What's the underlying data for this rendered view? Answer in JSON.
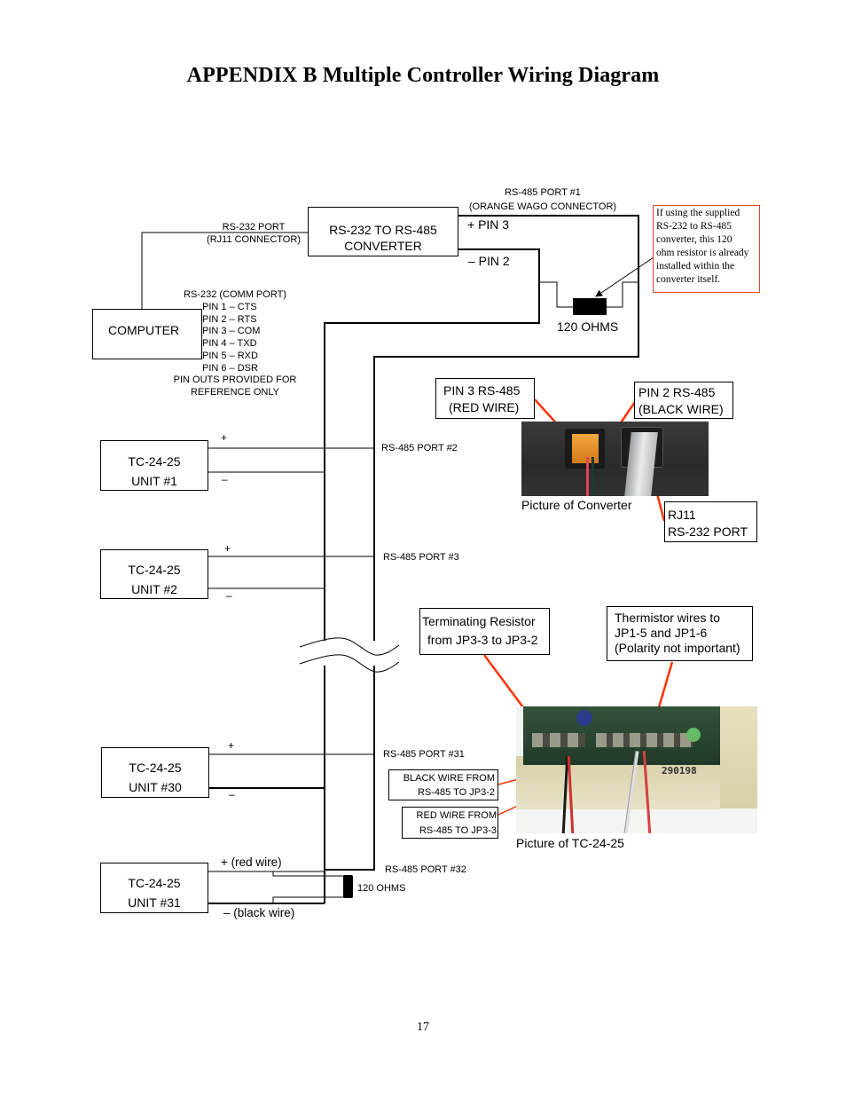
{
  "page": {
    "title": "APPENDIX B Multiple Controller Wiring Diagram",
    "page_number": "17"
  },
  "computer": {
    "label": "COMPUTER",
    "port_label": "RS-232 (COMM PORT)",
    "pins": [
      "PIN 1 – CTS",
      "PIN 2 – RTS",
      "PIN 3 – COM",
      "PIN 4 – TXD",
      "PIN 5 – RXD",
      "PIN 6 – DSR"
    ],
    "pin_note_line1": "PIN OUTS PROVIDED FOR",
    "pin_note_line2": "REFERENCE ONLY"
  },
  "converter": {
    "line1": "RS-232 TO RS-485",
    "line2": "CONVERTER",
    "rs232_port_line1": "RS-232 PORT",
    "rs232_port_line2": "(RJ11 CONNECTOR)",
    "rs485_port_line1": "RS-485 PORT #1",
    "rs485_port_line2": "(ORANGE WAGO CONNECTOR)",
    "pin3": "+ PIN 3",
    "pin2": "– PIN 2",
    "resistor": "120 OHMS"
  },
  "resistor_note": {
    "lines": [
      "If using the supplied",
      "RS-232 to RS-485",
      "converter, this 120",
      "ohm resistor is already",
      "installed within the",
      "converter itself."
    ],
    "border_color": "#e2452a"
  },
  "units": [
    {
      "model": "TC-24-25",
      "unit": "UNIT #1",
      "plus": "+",
      "minus": "–",
      "port": "RS-485 PORT #2"
    },
    {
      "model": "TC-24-25",
      "unit": "UNIT #2",
      "plus": "+",
      "minus": "–",
      "port": "RS-485 PORT #3"
    },
    {
      "model": "TC-24-25",
      "unit": "UNIT #30",
      "plus": "+",
      "minus": "–",
      "port": "RS-485 PORT #31"
    },
    {
      "model": "TC-24-25",
      "unit": "UNIT #31",
      "plus": "+ (red wire)",
      "minus": "– (black wire)",
      "port": "RS-485 PORT #32"
    }
  ],
  "end_resistor": "120 OHMS",
  "converter_photo": {
    "caption": "Picture of Converter",
    "callout_pin3_line1": "PIN 3 RS-485",
    "callout_pin3_line2": "(RED WIRE)",
    "callout_pin2_line1": "PIN 2 RS-485",
    "callout_pin2_line2": "(BLACK WIRE)",
    "callout_rj11_line1": "RJ11",
    "callout_rj11_line2": "RS-232 PORT"
  },
  "tc_photo": {
    "caption": "Picture of TC-24-25",
    "callout_term_line1": "Terminating Resistor",
    "callout_term_line2": "from JP3-3 to JP3-2",
    "callout_therm_line1": "Thermistor wires to",
    "callout_therm_line2": "JP1-5 and JP1-6",
    "callout_therm_line3": "(Polarity not important)",
    "callout_black_line1": "BLACK WIRE FROM",
    "callout_black_line2": "RS-485 TO JP3-2",
    "callout_red_line1": "RED WIRE FROM",
    "callout_red_line2": "RS-485 TO JP3-3",
    "board_stamp": "290198"
  },
  "colors": {
    "callout_arrow": "#ff3300",
    "note_border": "#e2452a"
  }
}
